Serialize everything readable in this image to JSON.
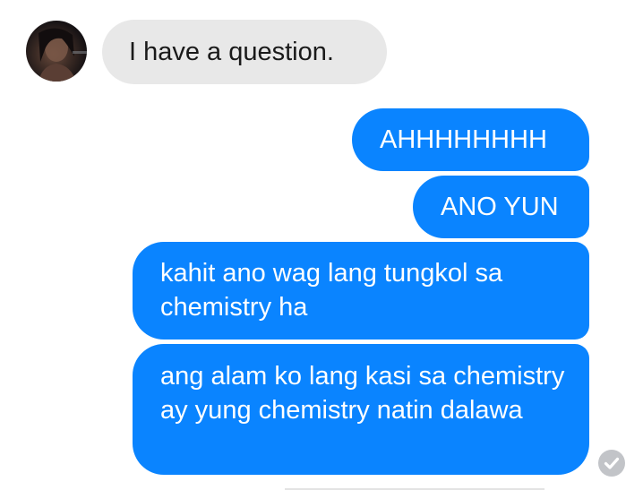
{
  "conversation": {
    "contact_avatar_icon": "contact-avatar-photo",
    "messages": [
      {
        "sender": "contact",
        "text": "I have a question."
      },
      {
        "sender": "self",
        "text": "AHHHHHHHH"
      },
      {
        "sender": "self",
        "text": "ANO YUN"
      },
      {
        "sender": "self",
        "text": "kahit ano wag lang tungkol sa chemistry ha"
      },
      {
        "sender": "self",
        "text": "ang alam ko lang kasi sa chemistry ay yung chemistry natin dalawa"
      }
    ],
    "read_receipt_icon": "check-circle-icon"
  },
  "colors": {
    "outgoing_bubble": "#0a84ff",
    "incoming_bubble": "#e8e8e8",
    "read_receipt": "#c2c4c8"
  }
}
